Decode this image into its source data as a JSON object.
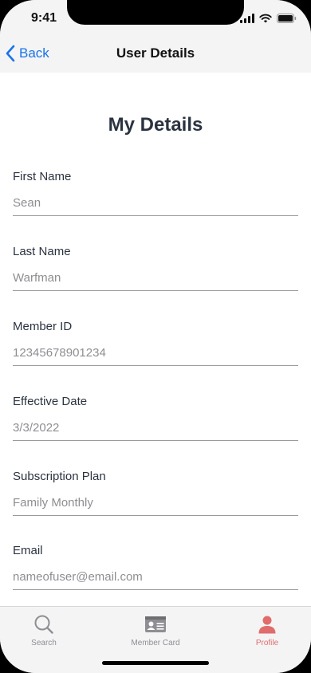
{
  "status_bar": {
    "time": "9:41"
  },
  "nav": {
    "back_label": "Back",
    "title": "User Details"
  },
  "page": {
    "title": "My Details"
  },
  "fields": [
    {
      "label": "First Name",
      "value": "Sean"
    },
    {
      "label": "Last Name",
      "value": "Warfman"
    },
    {
      "label": "Member ID",
      "value": "12345678901234"
    },
    {
      "label": "Effective Date",
      "value": "3/3/2022"
    },
    {
      "label": "Subscription Plan",
      "value": "Family Monthly"
    },
    {
      "label": "Email",
      "value": "nameofuser@email.com"
    }
  ],
  "tabs": [
    {
      "label": "Search",
      "icon": "search-icon",
      "active": false
    },
    {
      "label": "Member Card",
      "icon": "id-card-icon",
      "active": false
    },
    {
      "label": "Profile",
      "icon": "person-icon",
      "active": true
    }
  ],
  "colors": {
    "accent": "#1a73e8",
    "active_tab": "#e06c6c",
    "inactive_tab": "#8e8e93",
    "heading": "#2b3340"
  }
}
